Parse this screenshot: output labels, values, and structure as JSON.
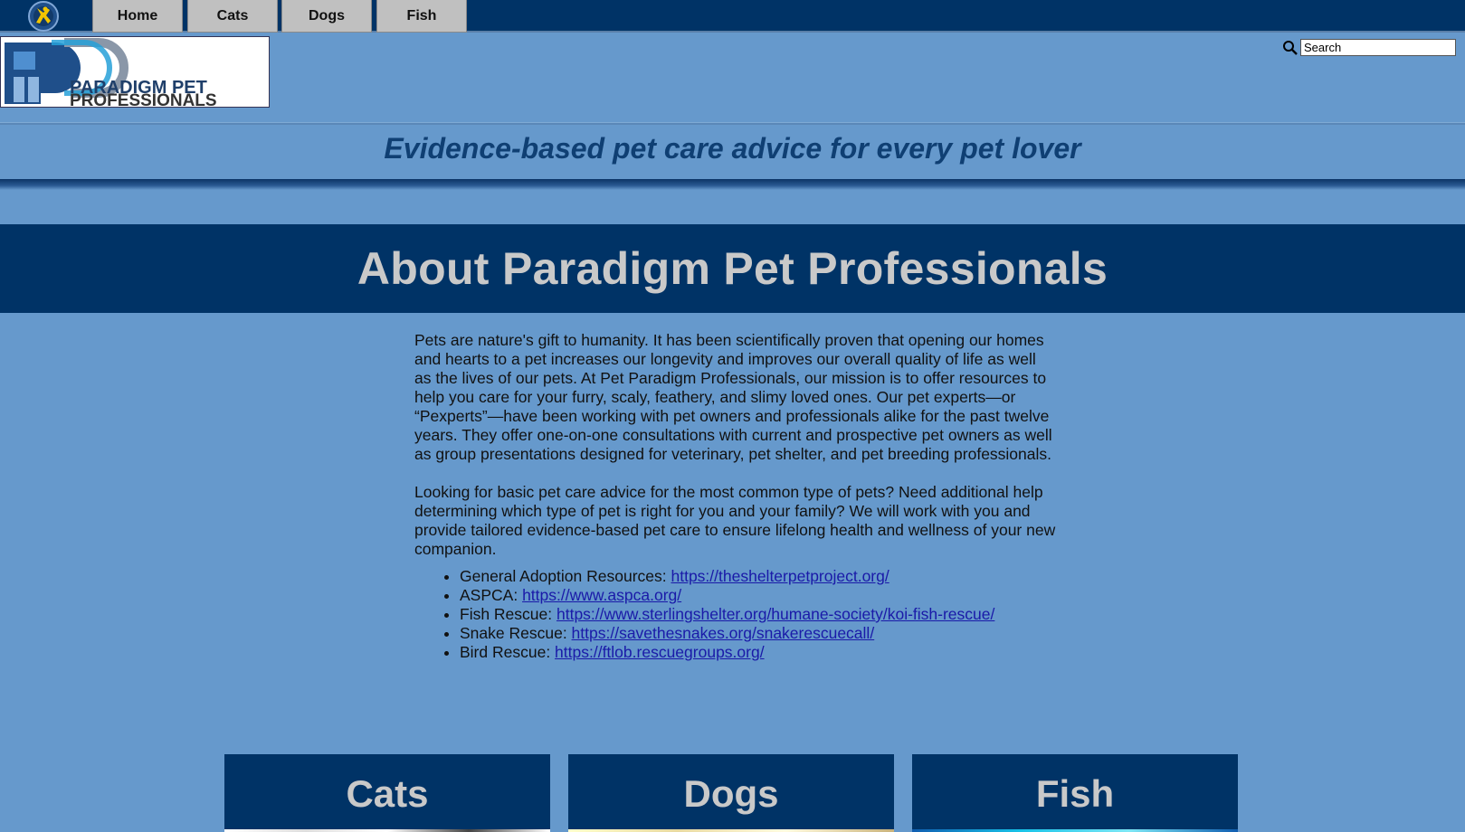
{
  "nav": {
    "logo_icon": "paradigm-badge-icon",
    "tabs": [
      {
        "label": "Home"
      },
      {
        "label": "Cats"
      },
      {
        "label": "Dogs"
      },
      {
        "label": "Fish"
      }
    ]
  },
  "header": {
    "logo_text_line1": "PARADIGM PET",
    "logo_text_line2": "PROFESSIONALS",
    "search_placeholder": "Search",
    "tagline": "Evidence-based pet care advice for every pet lover"
  },
  "about": {
    "title": "About Paradigm Pet Professionals",
    "paragraph1": "Pets are nature's gift to humanity. It has been scientifically proven that opening our homes and hearts to a pet increases our longevity and improves our overall quality of life as well as the lives of our pets. At Pet Paradigm Professionals, our mission is to offer resources to help you care for your furry, scaly, feathery, and slimy loved ones. Our pet experts—or “Pexperts”—have been working with pet owners and professionals alike for the past twelve years. They offer one-on-one consultations with current and prospective pet owners as well as group presentations designed for veterinary, pet shelter, and pet breeding professionals.",
    "paragraph2": "Looking for basic pet care advice for the most common type of pets? Need additional help determining which type of pet is right for you and your family? We will work with you and provide tailored evidence-based pet care to ensure lifelong health and wellness of your new companion.",
    "resources": [
      {
        "label": "General Adoption Resources: ",
        "url": "https://theshelterpetproject.org/"
      },
      {
        "label": "ASPCA: ",
        "url": "https://www.aspca.org/"
      },
      {
        "label": "Fish Rescue: ",
        "url": "https://www.sterlingshelter.org/humane-society/koi-fish-rescue/"
      },
      {
        "label": "Snake Rescue: ",
        "url": "https://savethesnakes.org/snakerescuecall/"
      },
      {
        "label": "Bird Rescue: ",
        "url": "https://ftlob.rescuegroups.org/"
      }
    ]
  },
  "tiles": [
    {
      "label": "Cats"
    },
    {
      "label": "Dogs"
    },
    {
      "label": "Fish"
    }
  ],
  "colors": {
    "page_bg": "#6699cc",
    "navy": "#003366",
    "tab_gray": "#c0c0c0",
    "link": "#1a1aa8"
  }
}
